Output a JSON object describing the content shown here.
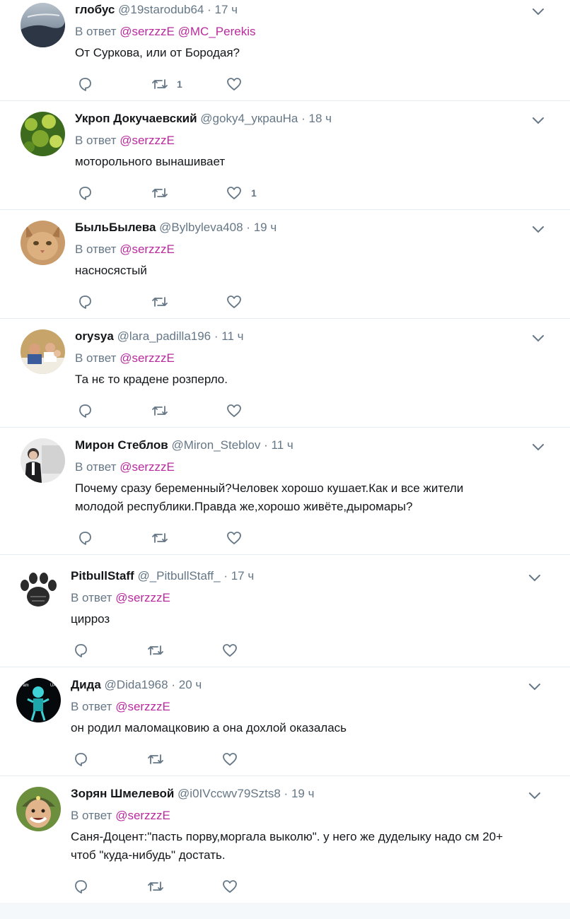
{
  "tweets": [
    {
      "name": "глобус",
      "handle": "@19starodub64",
      "time": "17 ч",
      "reply_prefix": "В ответ",
      "mentions": [
        "@serzzzE",
        "@MC_Perekis"
      ],
      "text": [
        "От Суркова, или от Бородая?"
      ],
      "counts": {
        "reply": "",
        "retweet": "1",
        "like": ""
      },
      "avatar": "landscape"
    },
    {
      "name": "Укроп Докучаевский",
      "handle": "@goky4_укpauHa",
      "time": "18 ч",
      "reply_prefix": "В ответ",
      "mentions": [
        "@serzzzE"
      ],
      "text": [
        "моторольного вынашивает"
      ],
      "counts": {
        "reply": "",
        "retweet": "",
        "like": "1"
      },
      "avatar": "plant"
    },
    {
      "name": "БыльБылева",
      "handle": "@Bylbyleva408",
      "time": "19 ч",
      "reply_prefix": "В ответ",
      "mentions": [
        "@serzzzE"
      ],
      "text": [
        "насносястый"
      ],
      "counts": {
        "reply": "",
        "retweet": "",
        "like": ""
      },
      "avatar": "cat"
    },
    {
      "name": "orysya",
      "handle": "@lara_padilla196",
      "time": "11 ч",
      "reply_prefix": "В ответ",
      "mentions": [
        "@serzzzE"
      ],
      "text": [
        "Та нє то крадене розперло."
      ],
      "counts": {
        "reply": "",
        "retweet": "",
        "like": ""
      },
      "avatar": "people"
    },
    {
      "name": "Мирон Стеблов",
      "handle": "@Miron_Steblov",
      "time": "11 ч",
      "reply_prefix": "В ответ",
      "mentions": [
        "@serzzzE"
      ],
      "text": [
        "Почему сразу беременный?Человек хорошо кушает.Как и все жители",
        "молодой республики.Правда же,хорошо живёте,дыромары?"
      ],
      "counts": {
        "reply": "",
        "retweet": "",
        "like": ""
      },
      "avatar": "man"
    },
    {
      "name": "PitbullStaff",
      "handle": "@_PitbullStaff_",
      "time": "17 ч",
      "reply_prefix": "В ответ",
      "mentions": [
        "@serzzzE"
      ],
      "text": [
        "цирроз"
      ],
      "counts": {
        "reply": "",
        "retweet": "",
        "like": ""
      },
      "avatar": "paw"
    },
    {
      "name": "Дида",
      "handle": "@Dida1968",
      "time": "20 ч",
      "reply_prefix": "В ответ",
      "mentions": [
        "@serzzzE"
      ],
      "text": [
        "он родил маломацковию а она дохлой оказалась"
      ],
      "counts": {
        "reply": "",
        "retweet": "",
        "like": ""
      },
      "avatar": "xray",
      "avatar_text_left": "I am",
      "avatar_text_right": "UA"
    },
    {
      "name": "Зорян Шмелевой",
      "handle": "@i0IVccwv79Szts8",
      "time": "19 ч",
      "reply_prefix": "В ответ",
      "mentions": [
        "@serzzzE"
      ],
      "text": [
        "Саня-Доцент:\"пасть порву,моргала выколю\". у него же дуделыку надо см 20+",
        "чтоб \"куда-нибудь\" достать."
      ],
      "counts": {
        "reply": "",
        "retweet": "",
        "like": ""
      },
      "avatar": "smile"
    }
  ],
  "colors": {
    "mention": "#b92a9d",
    "muted": "#657786",
    "divider": "#e6ecf0",
    "text": "#14171a"
  },
  "icons": {
    "reply": "reply-icon",
    "retweet": "retweet-icon",
    "like": "heart-icon",
    "menu": "chevron-down-icon"
  }
}
